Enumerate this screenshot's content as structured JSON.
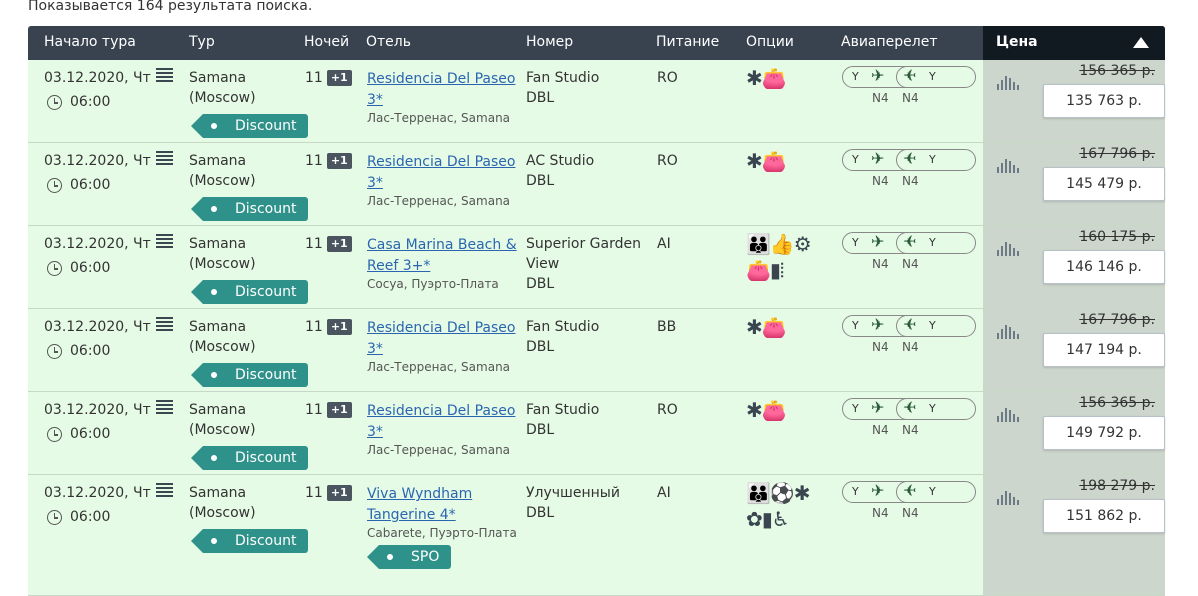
{
  "results_text": "Показывается 164 результата поиска.",
  "header": {
    "start": "Начало тура",
    "tour": "Тур",
    "nights": "Ночей",
    "hotel": "Отель",
    "room": "Номер",
    "meal": "Питание",
    "options": "Опции",
    "flight": "Авиаперелет",
    "price": "Цена"
  },
  "rows": [
    {
      "date": "03.12.2020, Чт",
      "time": "06:00",
      "tour_city": "Samana",
      "tour_from": "(Moscow)",
      "tag": "Discount",
      "nights": "11",
      "nights_extra": "+1",
      "hotel_line1": "Residencia Del Paseo",
      "hotel_line2": "3*",
      "location": "Лас-Терренас, Samana",
      "room1": "Fan Studio",
      "room2": "DBL",
      "room3": "",
      "meal": "RO",
      "icons1": "✱👛",
      "icons2": "",
      "cls": "Y",
      "airline": "N4",
      "old_price": "156 365 р.",
      "price": "135 763 р.",
      "extra_tag": ""
    },
    {
      "date": "03.12.2020, Чт",
      "time": "06:00",
      "tour_city": "Samana",
      "tour_from": "(Moscow)",
      "tag": "Discount",
      "nights": "11",
      "nights_extra": "+1",
      "hotel_line1": "Residencia Del Paseo",
      "hotel_line2": "3*",
      "location": "Лас-Терренас, Samana",
      "room1": "AC Studio",
      "room2": "DBL",
      "room3": "",
      "meal": "RO",
      "icons1": "✱👛",
      "icons2": "",
      "cls": "Y",
      "airline": "N4",
      "old_price": "167 796 р.",
      "price": "145 479 р.",
      "extra_tag": ""
    },
    {
      "date": "03.12.2020, Чт",
      "time": "06:00",
      "tour_city": "Samana",
      "tour_from": "(Moscow)",
      "tag": "Discount",
      "nights": "11",
      "nights_extra": "+1",
      "hotel_line1": "Casa Marina Beach &",
      "hotel_line2": "Reef 3+*",
      "location": "Сосуа, Пуэрто-Плата",
      "room1": "Superior Garden",
      "room2": "View",
      "room3": "DBL",
      "meal": "AI",
      "icons1": "👪👍⚙",
      "icons2": "👛▮⦙",
      "cls": "Y",
      "airline": "N4",
      "old_price": "160 175 р.",
      "price": "146 146 р.",
      "extra_tag": ""
    },
    {
      "date": "03.12.2020, Чт",
      "time": "06:00",
      "tour_city": "Samana",
      "tour_from": "(Moscow)",
      "tag": "Discount",
      "nights": "11",
      "nights_extra": "+1",
      "hotel_line1": "Residencia Del Paseo",
      "hotel_line2": "3*",
      "location": "Лас-Терренас, Samana",
      "room1": "Fan Studio",
      "room2": "DBL",
      "room3": "",
      "meal": "BB",
      "icons1": "✱👛",
      "icons2": "",
      "cls": "Y",
      "airline": "N4",
      "old_price": "167 796 р.",
      "price": "147 194 р.",
      "extra_tag": ""
    },
    {
      "date": "03.12.2020, Чт",
      "time": "06:00",
      "tour_city": "Samana",
      "tour_from": "(Moscow)",
      "tag": "Discount",
      "nights": "11",
      "nights_extra": "+1",
      "hotel_line1": "Residencia Del Paseo",
      "hotel_line2": "3*",
      "location": "Лас-Терренас, Samana",
      "room1": "Fan Studio",
      "room2": "DBL",
      "room3": "",
      "meal": "RO",
      "icons1": "✱👛",
      "icons2": "",
      "cls": "Y",
      "airline": "N4",
      "old_price": "156 365 р.",
      "price": "149 792 р.",
      "extra_tag": ""
    },
    {
      "date": "03.12.2020, Чт",
      "time": "06:00",
      "tour_city": "Samana",
      "tour_from": "(Moscow)",
      "tag": "Discount",
      "nights": "11",
      "nights_extra": "+1",
      "hotel_line1": "Viva Wyndham",
      "hotel_line2": "Tangerine 4*",
      "location": "Cabarete, Пуэрто-Плата",
      "room1": "Улучшенный",
      "room2": "DBL",
      "room3": "",
      "meal": "AI",
      "icons1": "👪⚽✱",
      "icons2": "✿▮♿",
      "cls": "Y",
      "airline": "N4",
      "old_price": "198 279 р.",
      "price": "151 862 р.",
      "extra_tag": "SPO"
    }
  ]
}
